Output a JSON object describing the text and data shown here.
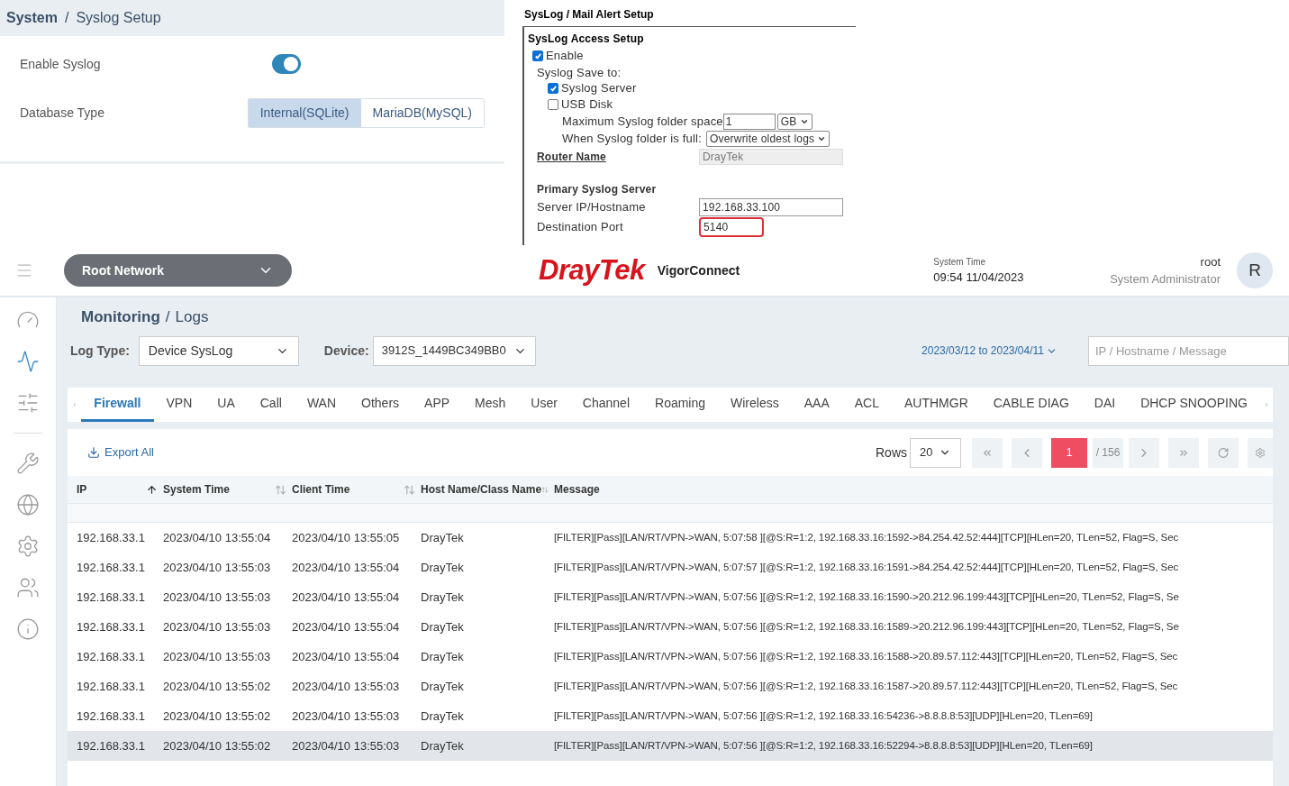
{
  "syslog_setup": {
    "breadcrumb": [
      "System",
      "/",
      "Syslog Setup"
    ],
    "enable": {
      "label": "Enable Syslog",
      "on": true
    },
    "database": {
      "label": "Database Type",
      "options": [
        {
          "label": "Internal(SQLite)",
          "selected": true
        },
        {
          "label": "MariaDB(MySQL)",
          "selected": false
        }
      ]
    }
  },
  "mail_alert": {
    "title": "SysLog / Mail Alert Setup",
    "section": "SysLog Access Setup",
    "enable": {
      "label": "Enable",
      "checked": true
    },
    "save_to": "Syslog Save to:",
    "targets": [
      {
        "label": "Syslog Server",
        "checked": true
      },
      {
        "label": "USB Disk",
        "checked": false
      }
    ],
    "max_space": {
      "label": "Maximum Syslog folder space",
      "value": "1",
      "unit": "GB"
    },
    "when_full": {
      "label": "When Syslog folder is full:",
      "value": "Overwrite oldest logs"
    },
    "router_name": {
      "label": "Router Name",
      "value": "DrayTek"
    },
    "primary": "Primary Syslog Server",
    "server": {
      "label": "Server IP/Hostname",
      "value": "192.168.33.100"
    },
    "port": {
      "label": "Destination Port",
      "value": "5140"
    }
  },
  "header": {
    "network": "Root Network",
    "brand": "DrayTek",
    "product": "VigorConnect",
    "time_label": "System Time",
    "time": "09:54 11/04/2023",
    "user": "root",
    "role": "System Administrator",
    "avatar": "R"
  },
  "sidebar": [
    {
      "selected": false
    },
    {
      "selected": true
    },
    {
      "selected": false
    },
    {
      "selected": false
    },
    {
      "selected": false
    },
    {
      "selected": false
    },
    {
      "selected": false
    },
    {
      "selected": false
    }
  ],
  "breadcrumb": [
    "Monitoring",
    "/",
    "Logs"
  ],
  "filters": {
    "log_type_label": "Log Type:",
    "log_type": "Device SysLog",
    "device_label": "Device:",
    "device": "3912S_1449BC349BB0",
    "date_range": "2023/03/12 to 2023/04/11",
    "search_placeholder": "IP / Hostname / Message"
  },
  "tabs": [
    {
      "label": "Firewall",
      "selected": true
    },
    {
      "label": "VPN",
      "selected": false
    },
    {
      "label": "UA",
      "selected": false
    },
    {
      "label": "Call",
      "selected": false
    },
    {
      "label": "WAN",
      "selected": false
    },
    {
      "label": "Others",
      "selected": false
    },
    {
      "label": "APP",
      "selected": false
    },
    {
      "label": "Mesh",
      "selected": false
    },
    {
      "label": "User",
      "selected": false
    },
    {
      "label": "Channel",
      "selected": false
    },
    {
      "label": "Roaming",
      "selected": false
    },
    {
      "label": "Wireless",
      "selected": false
    },
    {
      "label": "AAA",
      "selected": false
    },
    {
      "label": "ACL",
      "selected": false
    },
    {
      "label": "AUTHMGR",
      "selected": false
    },
    {
      "label": "CABLE DIAG",
      "selected": false
    },
    {
      "label": "DAI",
      "selected": false
    },
    {
      "label": "DHCP SNOOPING",
      "selected": false
    }
  ],
  "toolbar": {
    "export": "Export All",
    "rows_label": "Rows",
    "rows": "20",
    "page": "1",
    "pages": "/ 156"
  },
  "table": {
    "columns": [
      "IP",
      "System Time",
      "Client Time",
      "Host Name/Class Name",
      "Message"
    ],
    "rows": [
      {
        "selected": false,
        "cells": [
          "192.168.33.1",
          "2023/04/10 13:55:04",
          "2023/04/10 13:55:05",
          "DrayTek",
          "[FILTER][Pass][LAN/RT/VPN->WAN, 5:07:58 ][@S:R=1:2, 192.168.33.16:1592->84.254.42.52:444][TCP][HLen=20, TLen=52, Flag=S, Sec"
        ]
      },
      {
        "selected": false,
        "cells": [
          "192.168.33.1",
          "2023/04/10 13:55:03",
          "2023/04/10 13:55:04",
          "DrayTek",
          "[FILTER][Pass][LAN/RT/VPN->WAN, 5:07:57 ][@S:R=1:2, 192.168.33.16:1591->84.254.42.52:444][TCP][HLen=20, TLen=52, Flag=S, Sec"
        ]
      },
      {
        "selected": false,
        "cells": [
          "192.168.33.1",
          "2023/04/10 13:55:03",
          "2023/04/10 13:55:04",
          "DrayTek",
          "[FILTER][Pass][LAN/RT/VPN->WAN, 5:07:56 ][@S:R=1:2, 192.168.33.16:1590->20.212.96.199:443][TCP][HLen=20, TLen=52, Flag=S, Se"
        ]
      },
      {
        "selected": false,
        "cells": [
          "192.168.33.1",
          "2023/04/10 13:55:03",
          "2023/04/10 13:55:04",
          "DrayTek",
          "[FILTER][Pass][LAN/RT/VPN->WAN, 5:07:56 ][@S:R=1:2, 192.168.33.16:1589->20.212.96.199:443][TCP][HLen=20, TLen=52, Flag=S, Se"
        ]
      },
      {
        "selected": false,
        "cells": [
          "192.168.33.1",
          "2023/04/10 13:55:03",
          "2023/04/10 13:55:04",
          "DrayTek",
          "[FILTER][Pass][LAN/RT/VPN->WAN, 5:07:56 ][@S:R=1:2, 192.168.33.16:1588->20.89.57.112:443][TCP][HLen=20, TLen=52, Flag=S, Sec"
        ]
      },
      {
        "selected": false,
        "cells": [
          "192.168.33.1",
          "2023/04/10 13:55:02",
          "2023/04/10 13:55:03",
          "DrayTek",
          "[FILTER][Pass][LAN/RT/VPN->WAN, 5:07:56 ][@S:R=1:2, 192.168.33.16:1587->20.89.57.112:443][TCP][HLen=20, TLen=52, Flag=S, Sec"
        ]
      },
      {
        "selected": false,
        "cells": [
          "192.168.33.1",
          "2023/04/10 13:55:02",
          "2023/04/10 13:55:03",
          "DrayTek",
          "[FILTER][Pass][LAN/RT/VPN->WAN, 5:07:56 ][@S:R=1:2, 192.168.33.16:54236->8.8.8.8:53][UDP][HLen=20, TLen=69]"
        ]
      },
      {
        "selected": true,
        "cells": [
          "192.168.33.1",
          "2023/04/10 13:55:02",
          "2023/04/10 13:55:03",
          "DrayTek",
          "[FILTER][Pass][LAN/RT/VPN->WAN, 5:07:56 ][@S:R=1:2, 192.168.33.16:52294->8.8.8.8:53][UDP][HLen=20, TLen=69]"
        ]
      }
    ]
  }
}
